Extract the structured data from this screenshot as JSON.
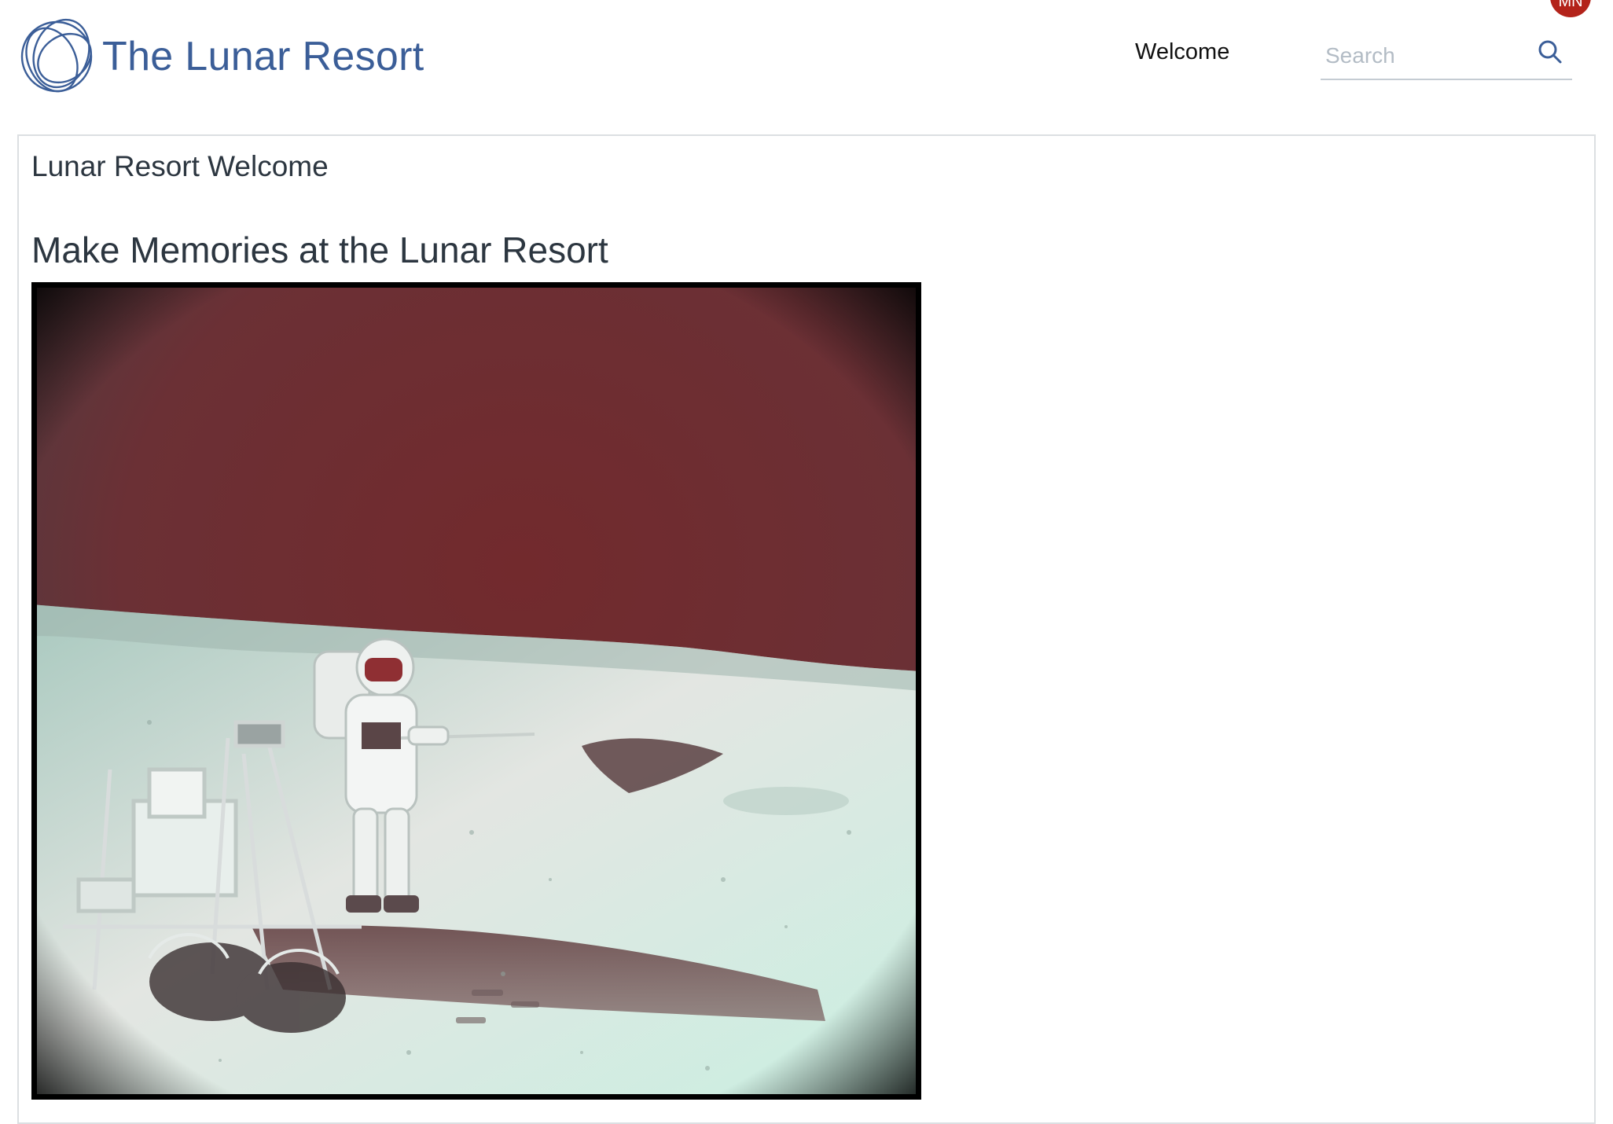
{
  "header": {
    "brand": "The Lunar Resort",
    "nav_welcome": "Welcome",
    "search_placeholder": "Search",
    "avatar_initials": "MN"
  },
  "main": {
    "title": "Lunar Resort Welcome",
    "heading": "Make Memories at the Lunar Resort"
  },
  "colors": {
    "brand": "#3b5e98",
    "avatar": "#b3231a",
    "sky": "#6e2a2e",
    "surface": "#cfe9df"
  }
}
